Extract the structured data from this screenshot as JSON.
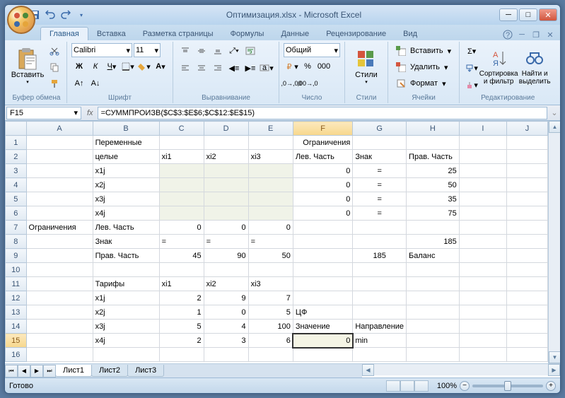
{
  "title": "Оптимизация.xlsx - Microsoft Excel",
  "tabs": [
    "Главная",
    "Вставка",
    "Разметка страницы",
    "Формулы",
    "Данные",
    "Рецензирование",
    "Вид"
  ],
  "active_tab": 0,
  "ribbon_groups": {
    "clipboard": {
      "label": "Буфер обмена",
      "paste": "Вставить"
    },
    "font": {
      "label": "Шрифт",
      "name": "Calibri",
      "size": "11"
    },
    "align": {
      "label": "Выравнивание"
    },
    "number": {
      "label": "Число",
      "format": "Общий"
    },
    "styles": {
      "label": "Стили",
      "btn": "Стили"
    },
    "cells": {
      "label": "Ячейки",
      "insert": "Вставить",
      "delete": "Удалить",
      "format": "Формат"
    },
    "editing": {
      "label": "Редактирование",
      "sort": "Сортировка и фильтр",
      "find": "Найти и выделить"
    }
  },
  "namebox": "F15",
  "formula": "=СУММПРОИЗВ($C$3:$E$6;$C$12:$E$15)",
  "columns": [
    "",
    "A",
    "B",
    "C",
    "D",
    "E",
    "F",
    "G",
    "H",
    "I",
    "J"
  ],
  "active_cell": {
    "row": 15,
    "col": "F",
    "value": "0"
  },
  "rows": [
    {
      "r": 1,
      "cells": {
        "B": "Переменные",
        "F": "Ограничения"
      }
    },
    {
      "r": 2,
      "cells": {
        "B": "целые",
        "C": "xi1",
        "D": "xi2",
        "E": "xi3",
        "F": "Лев. Часть",
        "G": "Знак",
        "H": "Прав. Часть"
      }
    },
    {
      "r": 3,
      "cells": {
        "B": "x1j",
        "F": "0",
        "G": "=",
        "H": "25"
      },
      "input": [
        "C",
        "D",
        "E"
      ]
    },
    {
      "r": 4,
      "cells": {
        "B": "x2j",
        "F": "0",
        "G": "=",
        "H": "50"
      },
      "input": [
        "C",
        "D",
        "E"
      ]
    },
    {
      "r": 5,
      "cells": {
        "B": "x3j",
        "F": "0",
        "G": "=",
        "H": "35"
      },
      "input": [
        "C",
        "D",
        "E"
      ]
    },
    {
      "r": 6,
      "cells": {
        "B": "x4j",
        "F": "0",
        "G": "=",
        "H": "75"
      },
      "input": [
        "C",
        "D",
        "E"
      ]
    },
    {
      "r": 7,
      "cells": {
        "A": "Ограничения",
        "B": "Лев. Часть",
        "C": "0",
        "D": "0",
        "E": "0"
      }
    },
    {
      "r": 8,
      "cells": {
        "B": "Знак",
        "C": "=",
        "D": "=",
        "E": "=",
        "H": "185"
      }
    },
    {
      "r": 9,
      "cells": {
        "B": "Прав. Часть",
        "C": "45",
        "D": "90",
        "E": "50",
        "G": "185",
        "H": "Баланс"
      }
    },
    {
      "r": 10,
      "cells": {}
    },
    {
      "r": 11,
      "cells": {
        "B": "Тарифы",
        "C": "xi1",
        "D": "xi2",
        "E": "xi3"
      }
    },
    {
      "r": 12,
      "cells": {
        "B": "x1j",
        "C": "2",
        "D": "9",
        "E": "7"
      }
    },
    {
      "r": 13,
      "cells": {
        "B": "x2j",
        "C": "1",
        "D": "0",
        "E": "5",
        "F": "ЦФ"
      }
    },
    {
      "r": 14,
      "cells": {
        "B": "x3j",
        "C": "5",
        "D": "4",
        "E": "100",
        "F": "Значение",
        "G": "Направление"
      }
    },
    {
      "r": 15,
      "cells": {
        "B": "x4j",
        "C": "2",
        "D": "3",
        "E": "6",
        "F": "0",
        "G": "min"
      }
    },
    {
      "r": 16,
      "cells": {}
    }
  ],
  "col_align": {
    "C": "num",
    "D": "num",
    "E": "num",
    "F": "num",
    "G": "ctr",
    "H": "num"
  },
  "text_cells": [
    "2C",
    "2D",
    "2E",
    "11C",
    "11D",
    "11E",
    "8C",
    "8D",
    "8E",
    "13F",
    "14F",
    "14G",
    "15G",
    "9H",
    "2F",
    "2G",
    "2H"
  ],
  "sheets": [
    "Лист1",
    "Лист2",
    "Лист3"
  ],
  "active_sheet": 0,
  "status": "Готово",
  "zoom": "100%",
  "chart_data": null
}
